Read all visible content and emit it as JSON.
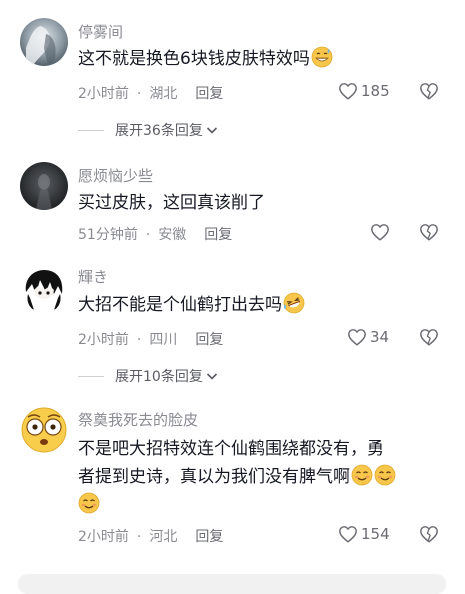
{
  "comments": [
    {
      "username": "停雾间",
      "text": "这不就是换色6块钱皮肤特效吗",
      "emojis": [
        "grin-sweat-emoji"
      ],
      "time": "2小时前",
      "location": "湖北",
      "reply_label": "回复",
      "likes": "185",
      "expand": "展开36条回复"
    },
    {
      "username": "愿烦恼少些",
      "text": "买过皮肤，这回真该削了",
      "emojis": [],
      "time": "51分钟前",
      "location": "安徽",
      "reply_label": "回复",
      "likes": ""
    },
    {
      "username": "輝き",
      "text": "大招不能是个仙鹤打出去吗",
      "emojis": [
        "rolling-laugh-emoji"
      ],
      "time": "2小时前",
      "location": "四川",
      "reply_label": "回复",
      "likes": "34",
      "expand": "展开10条回复"
    },
    {
      "username": "祭奠我死去的脸皮",
      "text_line1": "不是吧大招特效连个仙鹤围绕都没有，勇",
      "text_line2": "者提到史诗，真以为我们没有脾气啊",
      "emojis": [
        "blush-smile-emoji",
        "blush-smile-emoji",
        "blush-smile-emoji"
      ],
      "time": "2小时前",
      "location": "河北",
      "reply_label": "回复",
      "likes": "154"
    }
  ],
  "colors": {
    "primary_text": "#161823",
    "secondary_text": "#8a8b91",
    "icon": "#6b6c72",
    "divider": "#cfd0d4"
  }
}
